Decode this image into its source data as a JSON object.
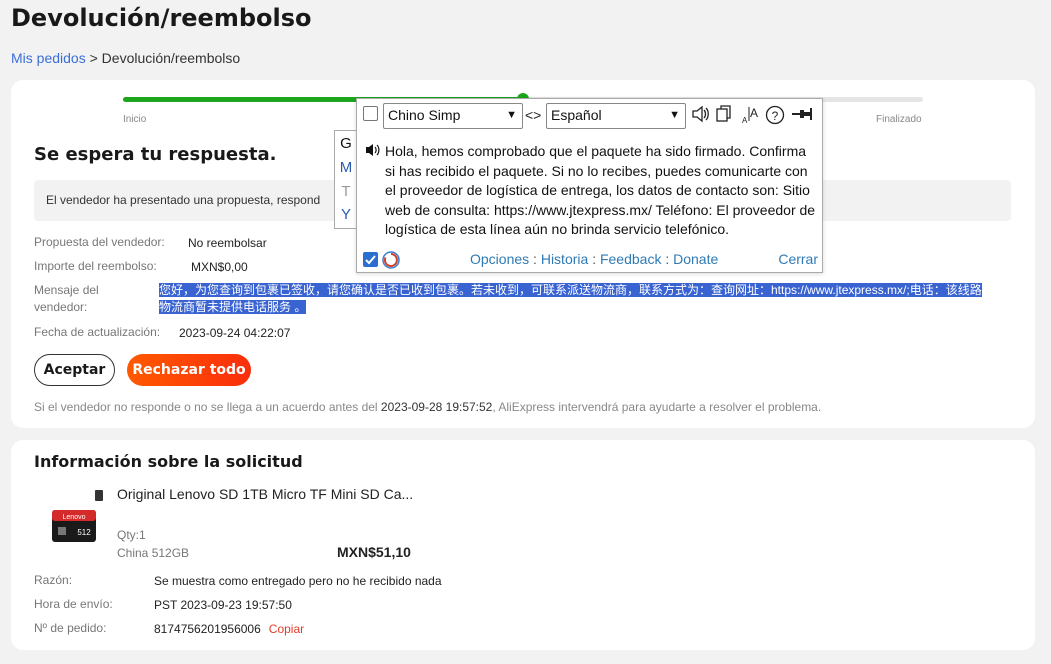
{
  "page": {
    "title": "Devolución/reembolso"
  },
  "breadcrumb": {
    "link": "Mis pedidos",
    "separator": ">",
    "current": "Devolución/reembolso"
  },
  "progress": {
    "start_label": "Inicio",
    "end_label": "Finalizado",
    "fraction": 0.5,
    "color": "#1ea51e"
  },
  "status": {
    "title": "Se espera tu respuesta.",
    "notice": "El vendedor ha presentado una propuesta, respond"
  },
  "details": {
    "proposal_label": "Propuesta del vendedor:",
    "proposal_value": "No reembolsar",
    "amount_label": "Importe del reembolso:",
    "amount_value": "MXN$0,00",
    "message_label_1": "Mensaje del",
    "message_label_2": "vendedor:",
    "message_line_1": "您好，为您查询到包裹已签收，请您确认是否已收到包裹。若未收到，可联系派送物流商，联系方式为：查询网址：https://www.jtexpress.mx/;电话：该线路",
    "message_line_2": "物流商暂未提供电话服务 。",
    "updated_label": "Fecha de actualización:",
    "updated_value": "2023-09-24 04:22:07"
  },
  "actions": {
    "accept": "Aceptar",
    "reject": "Rechazar todo"
  },
  "footnote": {
    "before": "Si el vendedor no responde o no se llega a un acuerdo antes del ",
    "date": "2023-09-28 19:57:52",
    "after": ", AliExpress intervendrá para ayudarte a resolver el problema."
  },
  "request": {
    "title": "Información sobre la solicitud",
    "product_name": "Original Lenovo SD 1TB Micro TF Mini SD Ca...",
    "thumb_brand": "Lenovo",
    "thumb_capacity": "512",
    "qty": "Qty:1",
    "variant": "China 512GB",
    "price": "MXN$51,10",
    "reason_label": "Razón:",
    "reason_value": "Se muestra como entregado pero no he recibido nada",
    "shipped_label": "Hora de envío:",
    "shipped_value": "PST 2023-09-23 19:57:50",
    "order_label": "Nº de pedido:",
    "order_value": "8174756201956006",
    "copy_label": "Copiar"
  },
  "translator": {
    "source_lang": "Chino Simp",
    "target_lang": "Español",
    "swap_icon": "<>",
    "translation": "Hola, hemos comprobado que el paquete ha sido firmado. Confirma si has recibido el paquete. Si no lo recibes, puedes comunicarte con el proveedor de logística de entrega, los datos de contacto son: Sitio web de consulta: https://www.jtexpress.mx/ Teléfono: El proveedor de logística de esta línea aún no brinda servicio telefónico.",
    "tabs": [
      "G",
      "M",
      "T",
      "Y"
    ],
    "links": [
      "Opciones",
      "Historia",
      "Feedback",
      "Donate"
    ],
    "link_separator": ":",
    "close": "Cerrar",
    "icons": [
      "speaker-icon",
      "copy-icon",
      "font-size-icon",
      "help-icon",
      "pin-icon"
    ]
  }
}
